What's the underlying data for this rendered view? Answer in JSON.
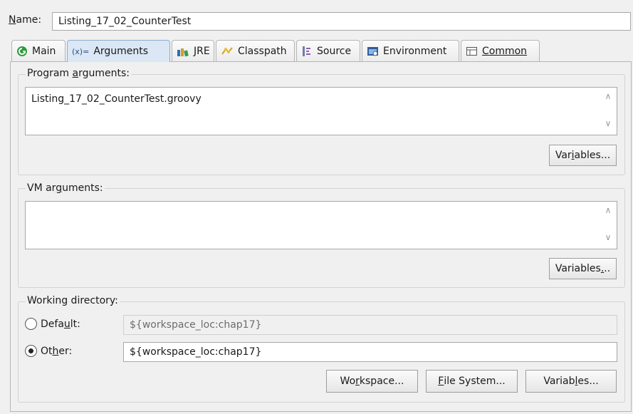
{
  "name": {
    "label": "Name:",
    "value": "Listing_17_02_CounterTest"
  },
  "tabs": [
    {
      "label": "Main",
      "icon": "green-run-icon",
      "active": false
    },
    {
      "label": "Arguments",
      "prefix": "(x)=",
      "icon": "arguments-icon",
      "active": true
    },
    {
      "label": "JRE",
      "icon": "jre-books-icon",
      "active": false
    },
    {
      "label": "Classpath",
      "icon": "classpath-icon",
      "active": false
    },
    {
      "label": "Source",
      "icon": "source-icon",
      "active": false
    },
    {
      "label": "Environment",
      "icon": "environment-icon",
      "active": false
    },
    {
      "label": "Common",
      "icon": "common-icon",
      "active": false
    }
  ],
  "program_arguments": {
    "label": "Program arguments:",
    "value": "Listing_17_02_CounterTest.groovy",
    "variables_button": "Variables..."
  },
  "vm_arguments": {
    "label": "VM arguments:",
    "value": "",
    "variables_button": "Variables..."
  },
  "working_directory": {
    "label": "Working directory:",
    "default_label": "Default:",
    "default_value": "${workspace_loc:chap17}",
    "other_label": "Other:",
    "other_value": "${workspace_loc:chap17}",
    "selected": "other",
    "workspace_button": "Workspace...",
    "file_system_button": "File System...",
    "variables_button": "Variables..."
  },
  "colors": {
    "active_tab": "#dbe7f5",
    "main_icon_green": "#2e9b3a"
  }
}
